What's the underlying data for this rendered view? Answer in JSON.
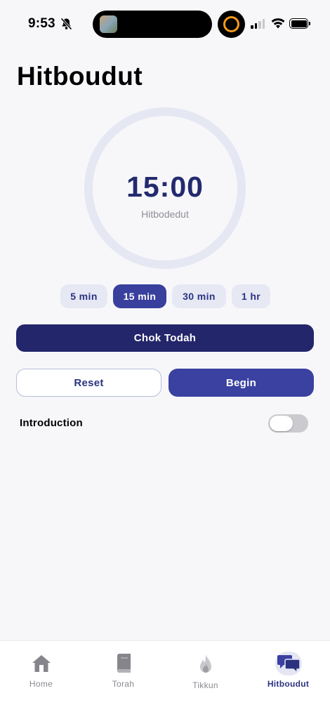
{
  "status_bar": {
    "time": "9:53",
    "icons": [
      "bell-slash-icon",
      "cellular-signal-icon",
      "wifi-icon",
      "battery-icon"
    ]
  },
  "page": {
    "title": "Hitboudut"
  },
  "timer": {
    "value": "15:00",
    "label": "Hitbodedut"
  },
  "presets": {
    "options": [
      {
        "label": "5 min"
      },
      {
        "label": "15 min"
      },
      {
        "label": "30 min"
      },
      {
        "label": "1 hr"
      }
    ],
    "selected": "15 min"
  },
  "actions": {
    "chok_todah": "Chok Todah",
    "reset": "Reset",
    "begin": "Begin"
  },
  "introduction": {
    "label": "Introduction",
    "enabled": false
  },
  "tabbar": {
    "tabs": [
      {
        "label": "Home",
        "icon": "home-icon"
      },
      {
        "label": "Torah",
        "icon": "book-icon"
      },
      {
        "label": "Tikkun",
        "icon": "flame-icon"
      },
      {
        "label": "Hitboudut",
        "icon": "chat-bubbles-icon"
      }
    ],
    "active": "Hitboudut"
  },
  "colors": {
    "primary_dark": "#23266b",
    "primary": "#3a41a0",
    "accent_text": "#2b3380",
    "timer_ring": "#e5e7f2",
    "background": "#f7f7fa"
  }
}
